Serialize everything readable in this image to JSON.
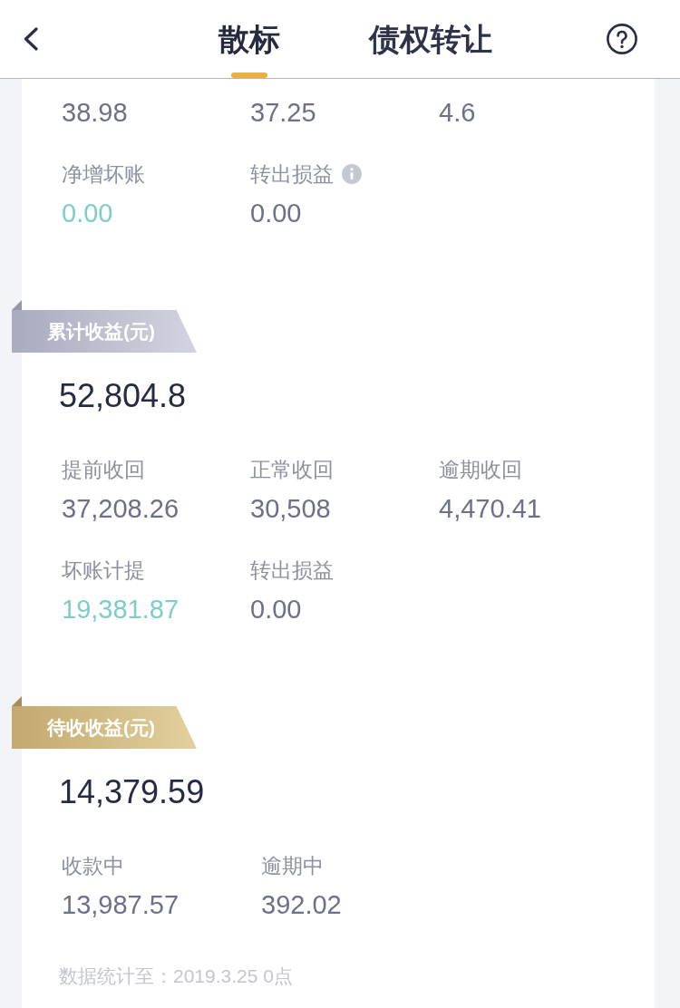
{
  "header": {
    "tabs": [
      {
        "label": "散标",
        "selected": true
      },
      {
        "label": "债权转让",
        "selected": false
      }
    ]
  },
  "sections": [
    {
      "stats": [
        {
          "value": "38.98",
          "color": "#6d7088"
        },
        {
          "value": "37.25",
          "color": "#6d7088"
        },
        {
          "value": "4.6",
          "color": "#6d7088"
        },
        {
          "label": "净增坏账",
          "value": "0.00",
          "color": "#7ecdc6"
        },
        {
          "label": "转出损益",
          "value": "0.00",
          "color": "#6d7088",
          "info": true
        }
      ]
    },
    {
      "ribbon": {
        "title": "累计收益(元)",
        "kind": "silver"
      },
      "total": "52,804.8",
      "stats": [
        {
          "label": "提前收回",
          "value": "37,208.26",
          "color": "#6d7088"
        },
        {
          "label": "正常收回",
          "value": "30,508",
          "color": "#6d7088"
        },
        {
          "label": "逾期收回",
          "value": "4,470.41",
          "color": "#6d7088"
        },
        {
          "label": "坏账计提",
          "value": "19,381.87",
          "color": "#7ecdc6"
        },
        {
          "label": "转出损益",
          "value": "0.00",
          "color": "#6d7088"
        }
      ]
    },
    {
      "ribbon": {
        "title": "待收收益(元)",
        "kind": "gold"
      },
      "total": "14,379.59",
      "stats": [
        {
          "label": "收款中",
          "value": "13,987.57",
          "color": "#6d7088"
        },
        {
          "label": "逾期中",
          "value": "392.02",
          "color": "#6d7088"
        }
      ]
    }
  ],
  "footer": "数据统计至：2019.3.25 0点"
}
